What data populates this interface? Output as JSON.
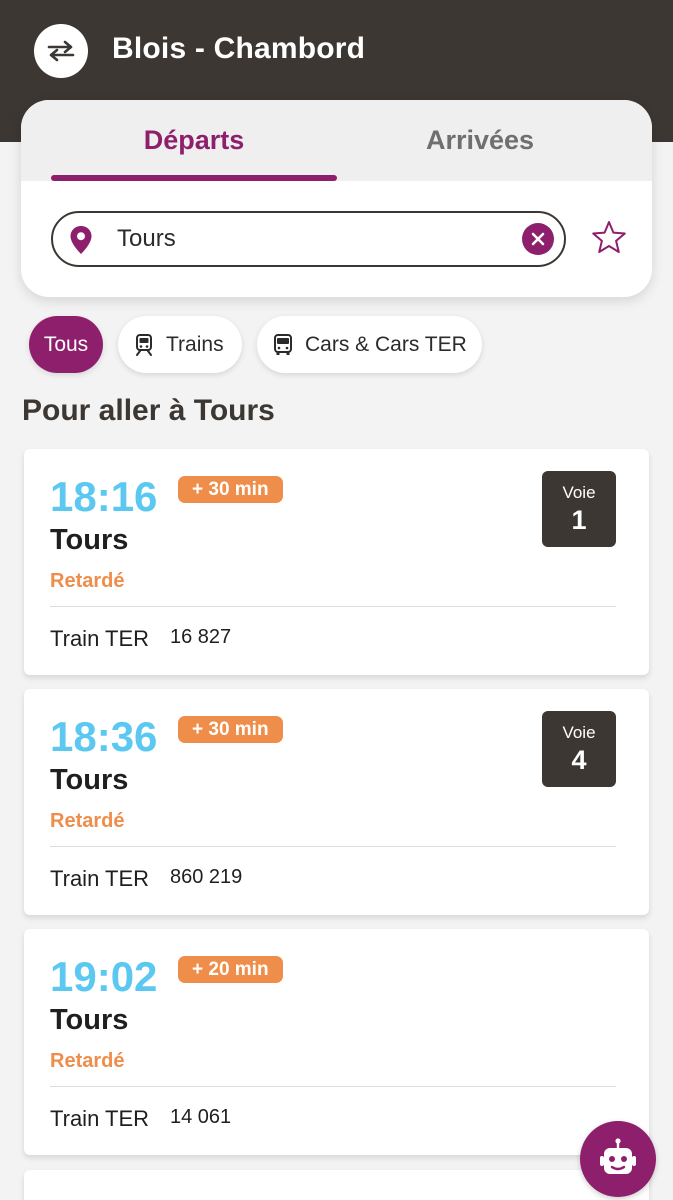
{
  "header": {
    "title": "Blois - Chambord"
  },
  "tabs": {
    "departures": "Départs",
    "arrivals": "Arrivées"
  },
  "search": {
    "value": "Tours"
  },
  "filters": {
    "all": "Tous",
    "trains": "Trains",
    "cars": "Cars & Cars TER"
  },
  "section_title": "Pour aller à Tours",
  "departures": [
    {
      "time": "18:16",
      "delay": "+ 30 min",
      "destination": "Tours",
      "status": "Retardé",
      "mode": "Train TER",
      "number": "16 827",
      "platform_label": "Voie",
      "platform": "1"
    },
    {
      "time": "18:36",
      "delay": "+ 30 min",
      "destination": "Tours",
      "status": "Retardé",
      "mode": "Train TER",
      "number": "860 219",
      "platform_label": "Voie",
      "platform": "4"
    },
    {
      "time": "19:02",
      "delay": "+ 20 min",
      "destination": "Tours",
      "status": "Retardé",
      "mode": "Train TER",
      "number": "14 061"
    }
  ],
  "colors": {
    "header_bg": "#3c3732",
    "accent": "#8e1f6c",
    "time": "#5ac8f0",
    "delay": "#ee8e4a",
    "background": "#f3f3f3"
  },
  "icons": {
    "swap": "swap-arrows-icon",
    "pin": "location-pin-icon",
    "clear": "clear-x-icon",
    "favorite": "star-outline-icon",
    "train": "train-icon",
    "bus": "bus-icon",
    "assistant": "robot-icon"
  }
}
